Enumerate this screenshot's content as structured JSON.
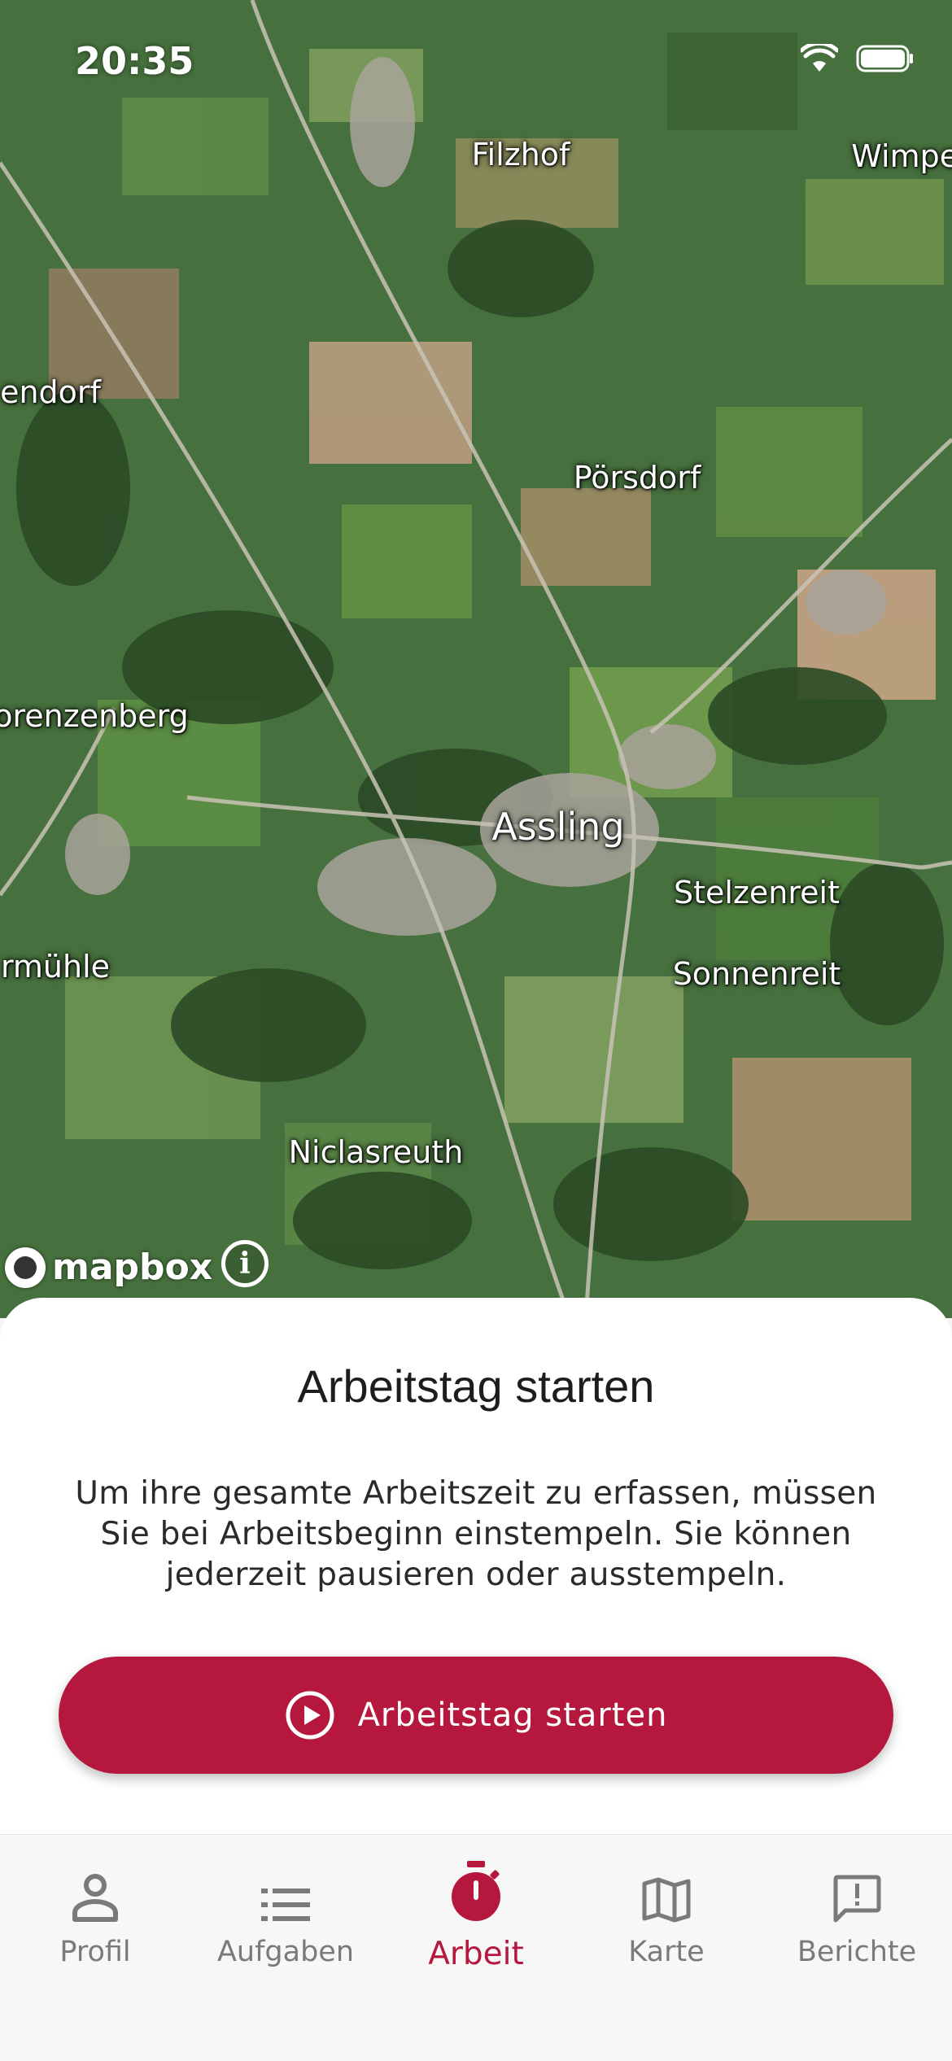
{
  "status_bar": {
    "time": "20:35"
  },
  "map": {
    "places": [
      {
        "name": "Filzhof"
      },
      {
        "name": "Wimper"
      },
      {
        "name": "endorf"
      },
      {
        "name": "Pörsdorf"
      },
      {
        "name": "orenzenberg"
      },
      {
        "name": "Assling"
      },
      {
        "name": "Stelzenreit"
      },
      {
        "name": "Sonnenreit"
      },
      {
        "name": "rmühle"
      },
      {
        "name": "Niclasreuth"
      }
    ],
    "attribution": "mapbox"
  },
  "sheet": {
    "title": "Arbeitstag starten",
    "description": "Um ihre gesamte Arbeitszeit zu erfassen, müssen Sie bei Arbeitsbeginn einstempeln. Sie können jederzeit pausieren oder ausstempeln.",
    "button_label": "Arbeitstag starten"
  },
  "tabs": [
    {
      "label": "Profil",
      "icon": "person-icon"
    },
    {
      "label": "Aufgaben",
      "icon": "list-icon"
    },
    {
      "label": "Arbeit",
      "icon": "stopwatch-icon",
      "active": true
    },
    {
      "label": "Karte",
      "icon": "map-icon"
    },
    {
      "label": "Berichte",
      "icon": "report-icon"
    }
  ],
  "colors": {
    "accent": "#b5183c",
    "tab_inactive": "#7a7a7a"
  }
}
